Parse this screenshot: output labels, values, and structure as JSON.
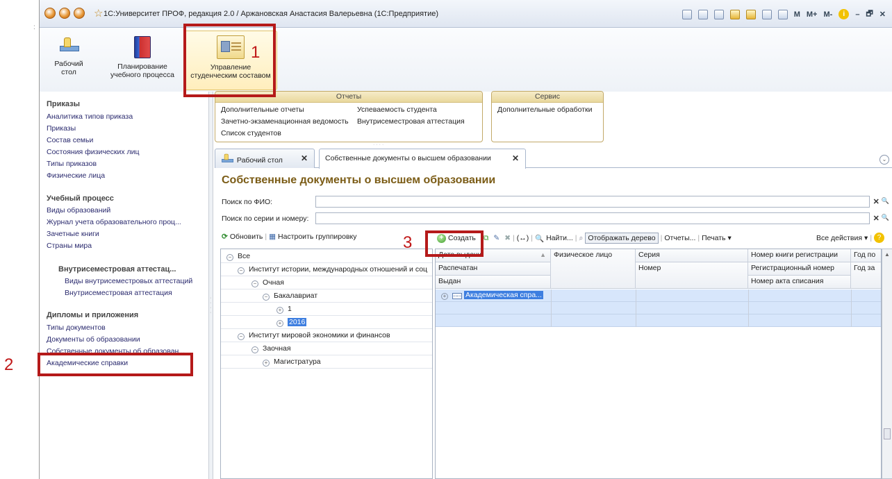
{
  "window": {
    "title": "1С:Университет ПРОФ, редакция 2.0 / Аржановская Анастасия Валерьевна  (1С:Предприятие)",
    "tool_letters": [
      "M",
      "M+",
      "M-"
    ],
    "controls": [
      "–",
      "🗗",
      "✕"
    ]
  },
  "sections": [
    {
      "label_line1": "Рабочий",
      "label_line2": "стол",
      "icon": "desk-icon"
    },
    {
      "label_line1": "Планирование",
      "label_line2": "учебного процесса",
      "icon": "book-icon"
    },
    {
      "label_line1": "Управление",
      "label_line2": "студенческим составом",
      "icon": "student-card-icon"
    }
  ],
  "leftnav": {
    "groups": [
      {
        "title": "Приказы",
        "items": [
          "Аналитика типов приказа",
          "Приказы",
          "Состав семьи",
          "Состояния физических лиц",
          "Типы приказов",
          "Физические лица"
        ]
      },
      {
        "title": "Учебный процесс",
        "items": [
          "Виды образований",
          "Журнал учета образовательного проц...",
          "Зачетные книги",
          "Страны мира"
        ]
      },
      {
        "title": "Внутрисеместровая аттестац...",
        "items": [
          "Виды внутрисеместровых аттестаций",
          "Внутрисеместровая аттестация"
        ]
      },
      {
        "title": "Дипломы и приложения",
        "items": [
          "Типы документов",
          "Документы об образовании",
          "Собственные документы об образован...",
          "Академические справки"
        ]
      }
    ]
  },
  "commands": {
    "reports": {
      "title": "Отчеты",
      "items": [
        "Дополнительные отчеты",
        "Зачетно-экзаменационная ведомость",
        "Список студентов",
        "Успеваемость студента",
        "Внутрисеместровая аттестация"
      ]
    },
    "service": {
      "title": "Сервис",
      "items": [
        "Дополнительные обработки"
      ]
    }
  },
  "tabs": [
    {
      "label": "Рабочий стол"
    },
    {
      "label": "Собственные документы о высшем образовании"
    }
  ],
  "form": {
    "title": "Собственные документы о высшем образовании",
    "search_fio_label": "Поиск по ФИО:",
    "search_series_label": "Поиск по серии и номеру:",
    "search_fio_value": "",
    "search_series_value": "",
    "clear_symbol": "✕",
    "find_symbol": "🔍"
  },
  "tree_toolbar": {
    "refresh": "Обновить",
    "grouping": "Настроить группировку"
  },
  "grid_toolbar": {
    "create": "Создать",
    "find": "Найти...",
    "show_tree": "Отображать дерево",
    "reports": "Отчеты...",
    "print": "Печать",
    "all_actions": "Все действия",
    "help": "?"
  },
  "tree": [
    {
      "label": "Все",
      "level": 0,
      "toggle": "⊖"
    },
    {
      "label": "Институт истории, международных отношений и соц",
      "level": 1,
      "toggle": "⊖"
    },
    {
      "label": "Очная",
      "level": 2,
      "toggle": "⊖"
    },
    {
      "label": "Бакалавриат",
      "level": 3,
      "toggle": "⊖"
    },
    {
      "label": "1",
      "level": 4,
      "toggle": "⊕"
    },
    {
      "label": "2016",
      "level": 4,
      "toggle": "⊕",
      "selected": true
    },
    {
      "label": "Институт мировой экономики и финансов",
      "level": 1,
      "toggle": "⊖"
    },
    {
      "label": "Заочная",
      "level": 2,
      "toggle": "⊖"
    },
    {
      "label": "Магистратура",
      "level": 3,
      "toggle": "⊕"
    }
  ],
  "grid": {
    "headers": {
      "col1": [
        "Дата выдачи",
        "Распечатан",
        "Выдан"
      ],
      "col2": [
        "Физическое лицо"
      ],
      "col3": [
        "Серия",
        "Номер"
      ],
      "col4": [
        "Номер книги регистрации",
        "Регистрационный номер",
        "Номер акта списания"
      ],
      "col5": [
        "Год по",
        "Год за"
      ]
    },
    "rows": [
      {
        "col1": "Академическая спра...",
        "group": true
      }
    ]
  },
  "annotations": [
    "1",
    "2",
    "3"
  ]
}
